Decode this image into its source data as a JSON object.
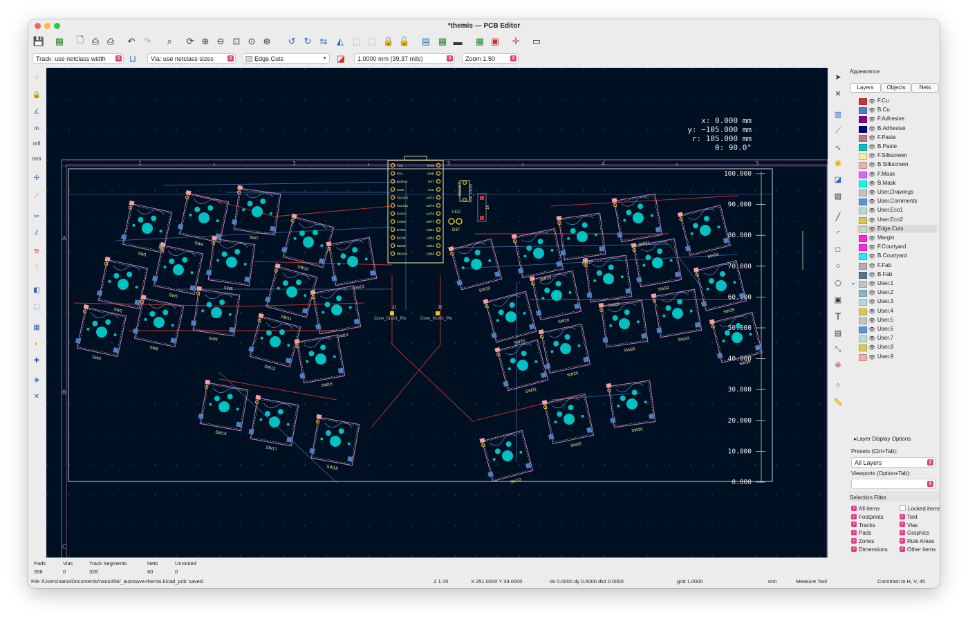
{
  "window": {
    "title": "*themis — PCB Editor"
  },
  "toolbar2": {
    "track": "Track: use netclass width",
    "via": "Via: use netclass sizes",
    "layer": "Edge.Cuts",
    "grid": "1.0000 mm (39.37 mils)",
    "zoom": "Zoom 1.50"
  },
  "canvas": {
    "coords": {
      "x": "x: 0.000 mm",
      "y": "y: −105.000 mm",
      "r": "r: 105.000 mm",
      "theta": "θ: 90.0°"
    },
    "ruler": [
      "100.000",
      "90.000",
      "80.000",
      "70.000",
      "60.000",
      "50.000",
      "40.000",
      "30.000",
      "20.000",
      "10.000",
      "0.000"
    ],
    "border_cols": [
      "1",
      "2",
      "3",
      "4",
      "5"
    ],
    "border_rows": [
      "A",
      "B",
      "C"
    ],
    "conn_labels": [
      "Conn_01x01_Pin",
      "Conn_01x01_Pin"
    ],
    "conn_refs": [
      "J1",
      "J2"
    ],
    "mcu_left_pins": [
      "TX0",
      "RX1",
      "D1/TX0",
      "GND",
      "SDA/D2",
      "SCL/D3",
      "D4/A6",
      "C6/D5",
      "D7/E6",
      "B4/D8",
      "B5/D9",
      "B6/D10"
    ],
    "mcu_right_pins": [
      "RAW",
      "GND",
      "RST",
      "VCC",
      "A3/F4",
      "A2/F5",
      "A1/F6",
      "A0/F7",
      "15/B1",
      "14/B3",
      "16/B2",
      "10/B6"
    ],
    "other_parts": [
      "RESET",
      "SW_Push",
      "LED",
      "D37",
      "1k"
    ],
    "switches_left": [
      "SW1",
      "SW2",
      "SW3",
      "SW4",
      "SW5",
      "SW6",
      "SW7",
      "SW8",
      "SW9",
      "SW10",
      "SW11",
      "SW12",
      "SW13",
      "SW14",
      "SW15",
      "SW16",
      "SW17",
      "SW18"
    ],
    "switches_right": [
      "SW19",
      "SW20",
      "SW21",
      "SW22",
      "SW23",
      "SW24",
      "SW25",
      "SW26",
      "SW27",
      "SW28",
      "SW29",
      "SW30",
      "SW31",
      "SW32",
      "SW33",
      "SW34",
      "SW35",
      "SW36"
    ]
  },
  "panel": {
    "title": "Appearance",
    "tabs": [
      "Layers",
      "Objects",
      "Nets"
    ],
    "layers": [
      {
        "name": "F.Cu",
        "color": "#c83434"
      },
      {
        "name": "B.Cu",
        "color": "#4d7fc4"
      },
      {
        "name": "F.Adhesive",
        "color": "#84008a"
      },
      {
        "name": "B.Adhesive",
        "color": "#000084"
      },
      {
        "name": "F.Paste",
        "color": "#b27c8c"
      },
      {
        "name": "B.Paste",
        "color": "#00c2c2"
      },
      {
        "name": "F.Silkscreen",
        "color": "#f2eda1"
      },
      {
        "name": "B.Silkscreen",
        "color": "#e8b2a7"
      },
      {
        "name": "F.Mask",
        "color": "#d864ff"
      },
      {
        "name": "B.Mask",
        "color": "#02ffee"
      },
      {
        "name": "User.Drawings",
        "color": "#c2c2c2"
      },
      {
        "name": "User.Comments",
        "color": "#5994dc"
      },
      {
        "name": "User.Eco1",
        "color": "#b4dbd2"
      },
      {
        "name": "User.Eco2",
        "color": "#d8c852"
      },
      {
        "name": "Edge.Cuts",
        "color": "#d0d2cd"
      },
      {
        "name": "Margin",
        "color": "#ff26e2"
      },
      {
        "name": "F.Courtyard",
        "color": "#ff26e2"
      },
      {
        "name": "B.Courtyard",
        "color": "#26e9ff"
      },
      {
        "name": "F.Fab",
        "color": "#afafaf"
      },
      {
        "name": "B.Fab",
        "color": "#58748c"
      },
      {
        "name": "User.1",
        "color": "#c2c2c2"
      },
      {
        "name": "User.2",
        "color": "#89b2d1"
      },
      {
        "name": "User.3",
        "color": "#b4dbd2"
      },
      {
        "name": "User.4",
        "color": "#d8c852"
      },
      {
        "name": "User.5",
        "color": "#c2c2c2"
      },
      {
        "name": "User.6",
        "color": "#5994dc"
      },
      {
        "name": "User.7",
        "color": "#b4dbd2"
      },
      {
        "name": "User.8",
        "color": "#d8c852"
      },
      {
        "name": "User.9",
        "color": "#e8b2a7"
      }
    ],
    "layer_display_options": "Layer Display Options",
    "presets_label": "Presets (Ctrl+Tab):",
    "presets_value": "All Layers",
    "viewports_label": "Viewports (Option+Tab):",
    "selection_filter": "Selection Filter",
    "filters_left": [
      "All items",
      "Footprints",
      "Tracks",
      "Pads",
      "Zones",
      "Dimensions"
    ],
    "filters_right": [
      "Locked items",
      "Text",
      "Vias",
      "Graphics",
      "Rule Areas",
      "Other items"
    ]
  },
  "status": {
    "headers": [
      "Pads",
      "Vias",
      "Track Segments",
      "Nets",
      "Unrouted"
    ],
    "values": [
      "356",
      "0",
      "328",
      "60",
      "0"
    ],
    "message": "File '/Users/nano/Documents/nano356/_autosave-themis.kicad_pcb' saved.",
    "z": "Z 1.70",
    "xy": "X 251.0000  Y 39.0000",
    "delta": "dx 0.0000  dy 0.0000  dist 0.0000",
    "grid": "grid 1.0000",
    "units": "mm",
    "tool": "Measure Tool",
    "constraint": "Constrain to H, V, 45"
  }
}
